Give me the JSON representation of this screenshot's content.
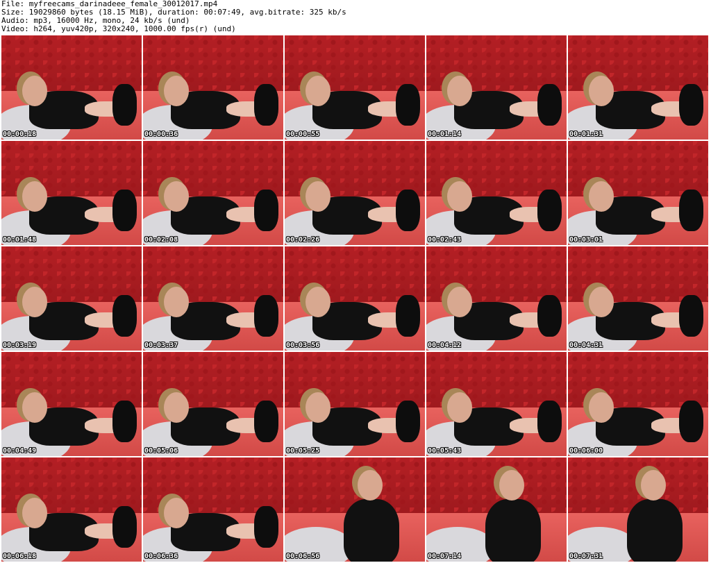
{
  "header": {
    "file_line": "File: myfreecams_darinadeee_female_30012017.mp4",
    "size_line": "Size: 19029860 bytes (18.15 MiB), duration: 00:07:49, avg.bitrate: 325 kb/s",
    "audio_line": "Audio: mp3, 16000 Hz, mono, 24 kb/s (und)",
    "video_line": "Video: h264, yuv420p, 320x240, 1000.00 fps(r) (und)"
  },
  "thumbnails": [
    {
      "timestamp": "00:00:18"
    },
    {
      "timestamp": "00:00:36"
    },
    {
      "timestamp": "00:00:55"
    },
    {
      "timestamp": "00:01:14"
    },
    {
      "timestamp": "00:01:31"
    },
    {
      "timestamp": "00:01:48"
    },
    {
      "timestamp": "00:02:08"
    },
    {
      "timestamp": "00:02:26"
    },
    {
      "timestamp": "00:02:43"
    },
    {
      "timestamp": "00:03:01"
    },
    {
      "timestamp": "00:03:19"
    },
    {
      "timestamp": "00:03:37"
    },
    {
      "timestamp": "00:03:56"
    },
    {
      "timestamp": "00:04:12"
    },
    {
      "timestamp": "00:04:31"
    },
    {
      "timestamp": "00:04:49"
    },
    {
      "timestamp": "00:05:06"
    },
    {
      "timestamp": "00:05:25"
    },
    {
      "timestamp": "00:05:43"
    },
    {
      "timestamp": "00:06:00"
    },
    {
      "timestamp": "00:06:18"
    },
    {
      "timestamp": "00:06:36"
    },
    {
      "timestamp": "00:06:56"
    },
    {
      "timestamp": "00:07:14"
    },
    {
      "timestamp": "00:07:31"
    }
  ]
}
